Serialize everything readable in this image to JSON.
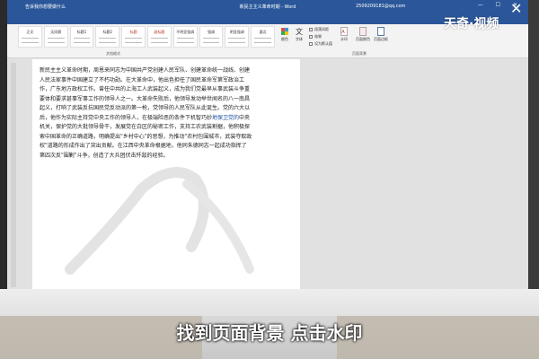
{
  "window": {
    "title": "新民主主义革命时期 - Word",
    "qat": "告诉我你想要做什么",
    "account": "2509209181@qq.com",
    "controls": "— ☐ ✕"
  },
  "ribbon": {
    "styles": [
      "正文",
      "无间隔",
      "标题1",
      "标题2",
      "标题",
      "副标题",
      "不明显强调",
      "强调",
      "明显强调",
      "要点"
    ],
    "styles_group": "文档格式",
    "colors_btn": "颜色",
    "fonts_btn": "字体",
    "effects_items": [
      "段落间距",
      "效果",
      "设为默认值"
    ],
    "watermark_btn": "水印",
    "page_color_btn": "页面颜色",
    "page_border_btn": "页面边框",
    "page_bg_group": "页面背景"
  },
  "document": {
    "lines": [
      "新民主主义革命时期，周恩来同志为中国共产党创建人民军队、创建革命统一战线、创建",
      "人民法家事件中国建立了不朽功勋。在大革命中，他出色担任了国民革命军第军政治工",
      "作，广东地方政权工作。曾任中共的上海工人武装起义，成为我们党最早从事武装斗争重",
      "要体和要求甚事军事工作的领导人之一。大革命失败后，他领导发动举世闻名的八一南昌",
      "起义，打响了武装反抗国民党反动派的第一枪，党领导的人民军队从此诞生。党的六大以",
      "后，他作为实际主持党中央工作的领导人，在极端险恶的条件下机智巧妙地保卫党的中央",
      "机关，保护党的大批领导骨干，发展党在白区的秘密工作，支持工农武装割据，他积极探",
      "索中国革命的正确道路，明确提出\"乡村中心\"的思想，为推动\"农村包围城市，武装夺取政",
      "权\"道路的形成作出了突出贡献。在江西中央革命根据地，他同朱德同志一起成功指挥了",
      "第四次反\"围剿\"斗争，创造了大兵团伏击歼敌的经验。"
    ],
    "highlight": "地保卫党的"
  },
  "overlay": {
    "brand": "天奇·视频",
    "close": "✕",
    "caption": "找到页面背景 点击水印"
  },
  "colors": {
    "word_blue": "#2b579a",
    "caption_text": "#ffffff"
  }
}
